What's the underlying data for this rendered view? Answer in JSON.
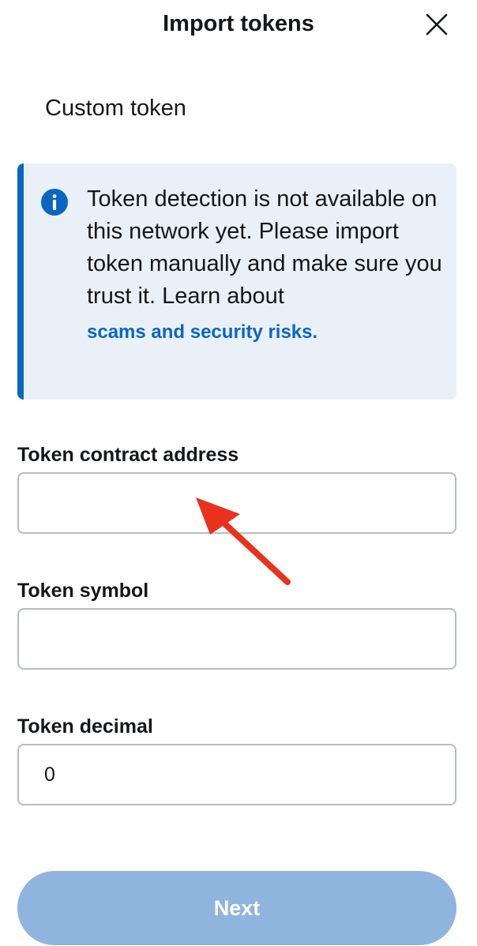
{
  "header": {
    "title": "Import tokens",
    "close_icon": "close-icon"
  },
  "tabs": [
    {
      "label": "Custom token",
      "active": true
    }
  ],
  "banner": {
    "icon": "info-icon",
    "text": "Token detection is not available on this network yet. Please import token manually and make sure you trust it. Learn about",
    "link_text": "scams and security risks.",
    "accent_color": "#0a66c2",
    "background_color": "#eaf0f8"
  },
  "form": {
    "contract_address": {
      "label": "Token contract address",
      "value": ""
    },
    "symbol": {
      "label": "Token symbol",
      "value": ""
    },
    "decimal": {
      "label": "Token decimal",
      "value": "0"
    }
  },
  "annotation": {
    "icon": "red-arrow-pointer",
    "color": "#e8321e",
    "points_to": "Token contract address input"
  },
  "footer": {
    "next_label": "Next",
    "next_disabled": true,
    "button_color": "#8fb4de"
  }
}
